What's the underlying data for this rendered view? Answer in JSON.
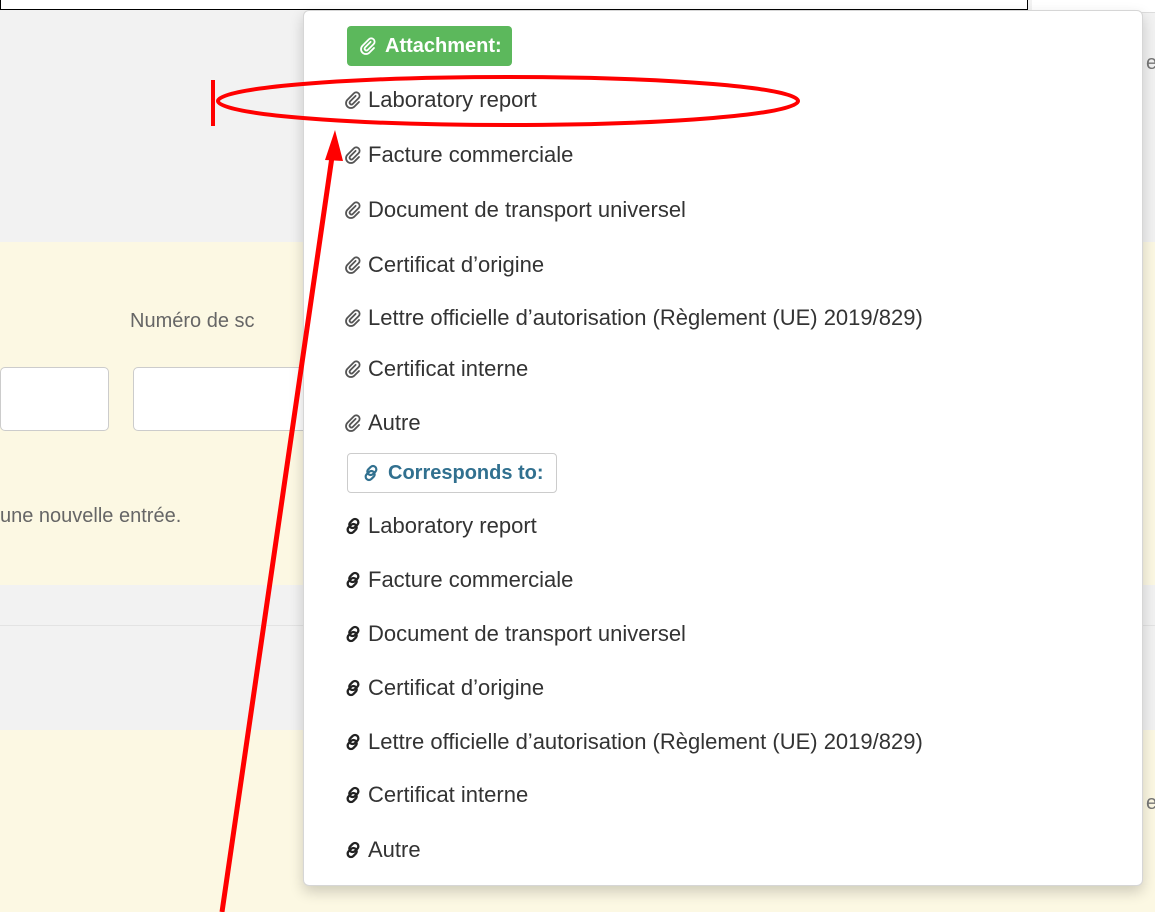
{
  "background": {
    "form_label": "Numéro de sc",
    "help_text": "une nouvelle entrée.",
    "edge_glyph_top": "e",
    "edge_glyph_bottom": "e"
  },
  "menu": {
    "attachment_header": "Attachment:",
    "attachment_items": [
      "Laboratory report",
      "Facture commerciale",
      "Document de transport universel",
      "Certificat d’origine",
      "Lettre officielle d’autorisation (Règlement (UE) 2019/829)",
      "Certificat interne",
      "Autre"
    ],
    "corresponds_header": "Corresponds to:",
    "corresponds_items": [
      "Laboratory report",
      "Facture commerciale",
      "Document de transport universel",
      "Certificat d’origine",
      "Lettre officielle d’autorisation (Règlement (UE) 2019/829)",
      "Certificat interne",
      "Autre"
    ]
  },
  "icons": {
    "attachment": "paperclip-icon",
    "corresponds": "link-icon"
  },
  "colors": {
    "attachment_badge": "#5cb85c",
    "corresponds_text": "#31708f",
    "annotation": "#ff0000",
    "panel_yellow": "#fcf8e3"
  }
}
